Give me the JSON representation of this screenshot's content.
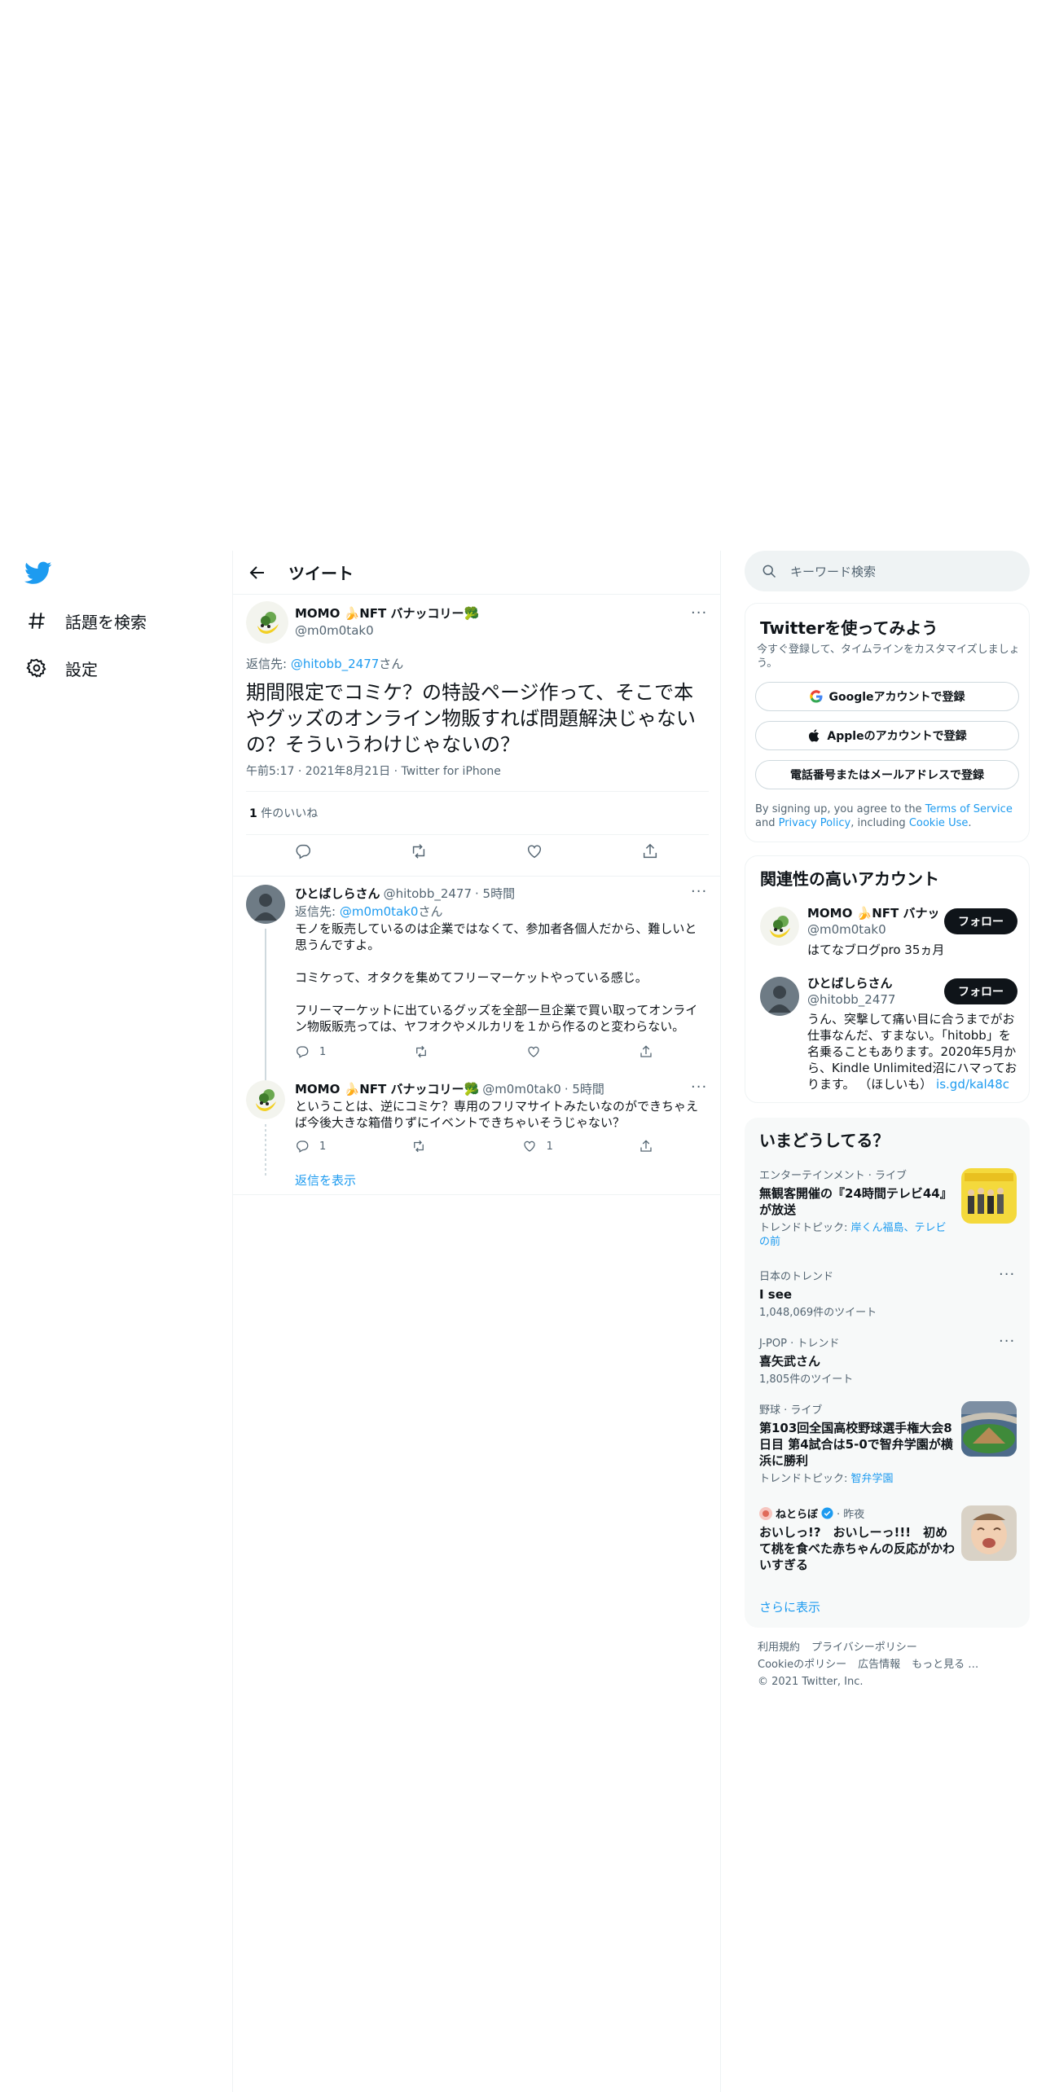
{
  "nav": {
    "items": [
      {
        "label": "話題を検索",
        "icon": "hashtag-icon"
      },
      {
        "label": "設定",
        "icon": "gear-icon"
      }
    ]
  },
  "header": {
    "title": "ツイート"
  },
  "tweet": {
    "author_name": "MOMO 🍌NFT バナッコリー🥦",
    "author_handle": "@m0m0tak0",
    "reply_prefix": "返信先: ",
    "reply_to": "@hitobb_2477",
    "reply_suffix": "さん",
    "text": "期間限定でコミケ？の特設ページ作って、そこで本やグッズのオンライン物販すれば問題解決じゃないの？そういうわけじゃないの？",
    "timestamp": "午前5:17 · 2021年8月21日 · Twitter for iPhone",
    "likes_count": "1",
    "likes_label": " 件のいいね"
  },
  "replies": [
    {
      "author_name": "ひとばしらさん",
      "author_handle": "@hitobb_2477",
      "time": " · 5時間",
      "reply_prefix": "返信先: ",
      "reply_to": "@m0m0tak0",
      "reply_suffix": "さん",
      "paragraphs": [
        "モノを販売しているのは企業ではなくて、参加者各個人だから、難しいと思うんですよ。",
        "コミケって、オタクを集めてフリーマーケットやっている感じ。",
        "フリーマーケットに出ているグッズを全部一旦企業で買い取ってオンライン物販販売っては、ヤフオクやメルカリを１から作るのと変わらない。"
      ],
      "reply_count": "1",
      "retweet_count": "",
      "like_count": ""
    },
    {
      "author_name": "MOMO 🍌NFT バナッコリー🥦",
      "author_handle": "@m0m0tak0",
      "time": " · 5時間",
      "paragraphs": [
        "ということは、逆にコミケ？専用のフリマサイトみたいなのができちゃえば今後大きな箱借りずにイベントできちゃいそうじゃない？"
      ],
      "reply_count": "1",
      "retweet_count": "",
      "like_count": "1"
    }
  ],
  "show_replies": "返信を表示",
  "search": {
    "placeholder": "キーワード検索"
  },
  "signup": {
    "title": "Twitterを使ってみよう",
    "subtitle": "今すぐ登録して、タイムラインをカスタマイズしましょう。",
    "google": "Googleアカウントで登録",
    "apple": "Appleのアカウントで登録",
    "phone": "電話番号またはメールアドレスで登録",
    "terms_1": "By signing up, you agree to the ",
    "terms_link": "Terms of Service",
    "terms_2": " and ",
    "privacy_link": "Privacy Policy",
    "terms_3": ", including ",
    "cookie_link": "Cookie Use",
    "terms_4": "."
  },
  "related": {
    "title": "関連性の高いアカウント",
    "accounts": [
      {
        "name": "MOMO 🍌NFT バナッ",
        "handle": "@m0m0tak0",
        "bio": "はてなブログpro 35ヵ月",
        "follow": "フォロー"
      },
      {
        "name": "ひとばしらさん",
        "handle": "@hitobb_2477",
        "bio": "うん、突撃して痛い目に合うまでがお仕事なんだ、すまない。「hitobb」を名乗ることもあります。2020年5月から、Kindle Unlimited沼にハマっております。 （ほしいも） ",
        "bio_link": "is.gd/kal48c",
        "follow": "フォロー"
      }
    ]
  },
  "trends": {
    "title": "いまどうしてる？",
    "items": [
      {
        "category": "エンターテインメント · ライブ",
        "title": "無観客開催の『24時間テレビ44』が放送",
        "sub_prefix": "トレンドトピック: ",
        "sub_link": "岸くん福島、テレビの前"
      },
      {
        "category": "日本のトレンド",
        "title": "I see",
        "sub": "1,048,069件のツイート"
      },
      {
        "category": "J-POP · トレンド",
        "title": "喜矢武さん",
        "sub": "1,805件のツイート"
      },
      {
        "category": "野球 · ライブ",
        "title": "第103回全国高校野球選手権大会8日目 第4試合は5-0で智弁学園が横浜に勝利",
        "sub_prefix": "トレンドトピック: ",
        "sub_link": "智弁学園"
      },
      {
        "category_name": "ねとらぼ",
        "category_time": " · 昨夜",
        "title": "おいしっ!?　おいしーっ!!!　初めて桃を食べた赤ちゃんの反応がかわいすぎる"
      }
    ],
    "show_more": "さらに表示"
  },
  "footer": {
    "line1": [
      "利用規約",
      "プライバシーポリシー"
    ],
    "line2": [
      "Cookieのポリシー",
      "広告情報",
      "もっと見る …"
    ],
    "copyright": "© 2021 Twitter, Inc."
  },
  "colors": {
    "accent": "#1d9bf0",
    "text": "#0f1419",
    "muted": "#536471",
    "border": "#eff3f4"
  }
}
